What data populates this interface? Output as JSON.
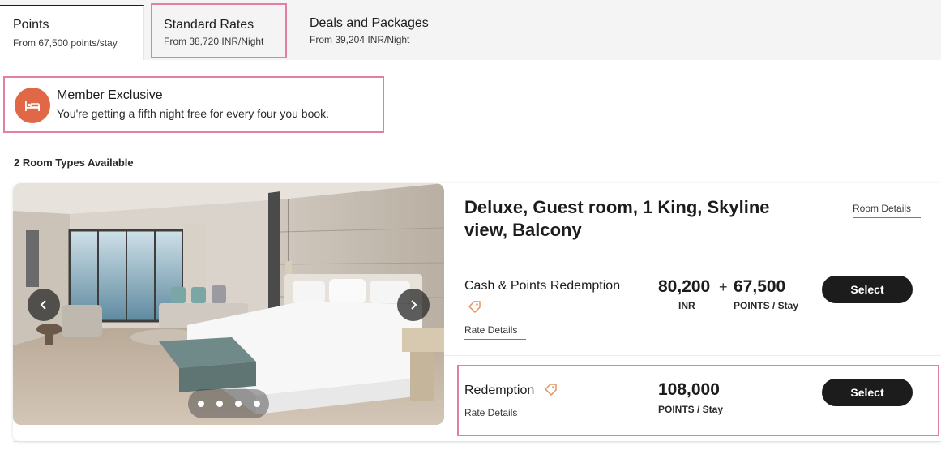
{
  "tabs": [
    {
      "label": "Points",
      "sub": "From 67,500 points/stay"
    },
    {
      "label": "Standard Rates",
      "sub": "From 38,720 INR/Night"
    },
    {
      "label": "Deals and Packages",
      "sub": "From 39,204 INR/Night"
    }
  ],
  "member": {
    "title": "Member Exclusive",
    "text": "You're getting a fifth night free for every four you book.",
    "icon": "bed-icon",
    "badge_color": "#e06846"
  },
  "room_count": "2 Room Types Available",
  "room": {
    "title": "Deluxe, Guest room, 1 King, Skyline view, Balcony",
    "details_link": "Room Details",
    "carousel_dots": 4,
    "rates": [
      {
        "name": "Cash & Points Redemption",
        "link": "Rate Details",
        "cash": "80,200",
        "cash_unit": "INR",
        "plus": "+",
        "points": "67,500",
        "points_unit": "POINTS / Stay",
        "button": "Select"
      },
      {
        "name": "Redemption",
        "link": "Rate Details",
        "points": "108,000",
        "points_unit": "POINTS / Stay",
        "button": "Select"
      }
    ]
  },
  "colors": {
    "highlight": "#e37fa6",
    "button": "#1c1c1c",
    "tag": "#e8925a"
  }
}
